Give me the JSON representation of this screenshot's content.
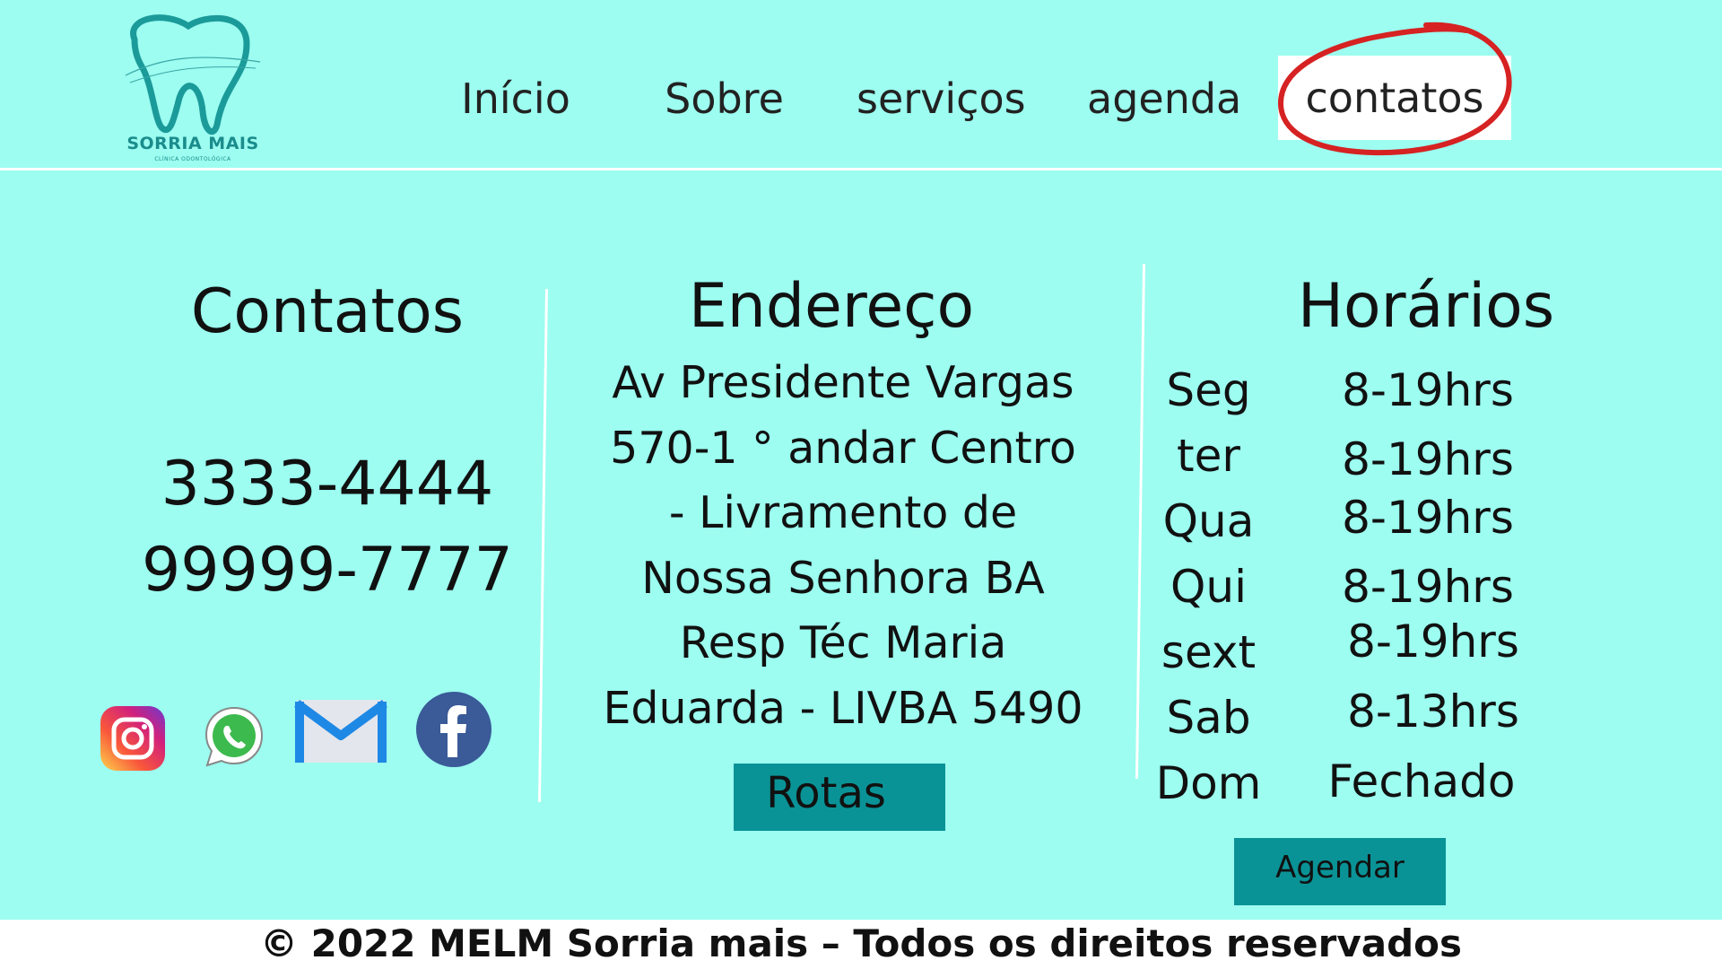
{
  "brand": {
    "name": "SORRIA MAIS",
    "tagline": "CLÍNICA ODONTOLÓGICA"
  },
  "nav": {
    "items": [
      "Início",
      "Sobre",
      "serviços",
      "agenda",
      "contatos"
    ],
    "active": "contatos"
  },
  "contatos": {
    "title": "Contatos",
    "phones": [
      "3333-4444",
      "99999-7777"
    ],
    "social_icons": [
      "instagram-icon",
      "whatsapp-icon",
      "gmail-icon",
      "facebook-icon"
    ]
  },
  "endereco": {
    "title": "Endereço",
    "lines": [
      "Av Presidente Vargas",
      "570-1 ° andar Centro",
      "- Livramento de",
      "Nossa Senhora BA",
      "Resp Téc Maria",
      "Eduarda - LIVBA 5490"
    ],
    "button_label": "Rotas"
  },
  "horarios": {
    "title": "Horários",
    "schedule": [
      {
        "day": "Seg",
        "hours": "8-19hrs"
      },
      {
        "day": "ter",
        "hours": "8-19hrs"
      },
      {
        "day": "Qua",
        "hours": "8-19hrs"
      },
      {
        "day": "Qui",
        "hours": "8-19hrs"
      },
      {
        "day": "sext",
        "hours": "8-19hrs"
      },
      {
        "day": "Sab",
        "hours": "8-13hrs"
      },
      {
        "day": "Dom",
        "hours": "Fechado"
      }
    ],
    "button_label": "Agendar"
  },
  "footer": {
    "text": "© 2022 MELM Sorria mais – Todos os direitos reservados"
  },
  "colors": {
    "background": "#9cfdf0",
    "button": "#0a9396",
    "logo": "#1b8c8c",
    "highlight_circle": "#d62222"
  }
}
